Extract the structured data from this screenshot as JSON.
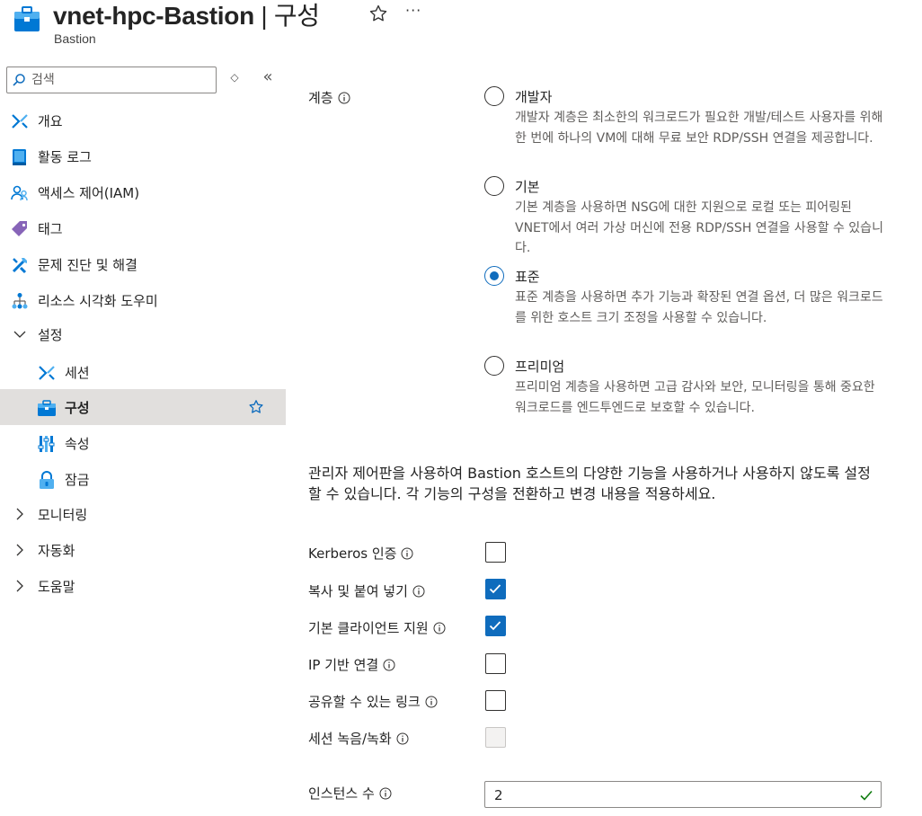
{
  "header": {
    "resource_name": "vnet-hpc-Bastion",
    "separator": " | ",
    "page_name": "구성",
    "subtitle": "Bastion",
    "more_label": "···"
  },
  "sidebar": {
    "search_placeholder": "검색",
    "sort_glyph": "◇",
    "collapse_glyph": "«",
    "items": [
      {
        "label": "개요",
        "icon": "overview-icon"
      },
      {
        "label": "활동 로그",
        "icon": "activity-log-icon"
      },
      {
        "label": "액세스 제어(IAM)",
        "icon": "iam-icon"
      },
      {
        "label": "태그",
        "icon": "tag-icon"
      },
      {
        "label": "문제 진단 및 해결",
        "icon": "diagnose-icon"
      },
      {
        "label": "리소스 시각화 도우미",
        "icon": "resource-visualizer-icon"
      },
      {
        "label": "설정",
        "icon": "chevron-down-icon",
        "expanded": true
      },
      {
        "label": "세션",
        "icon": "session-icon"
      },
      {
        "label": "구성",
        "icon": "configuration-icon",
        "selected": true
      },
      {
        "label": "속성",
        "icon": "properties-icon"
      },
      {
        "label": "잠금",
        "icon": "lock-icon"
      },
      {
        "label": "모니터링",
        "icon": "chevron-right-icon"
      },
      {
        "label": "자동화",
        "icon": "chevron-right-icon"
      },
      {
        "label": "도움말",
        "icon": "chevron-right-icon"
      }
    ]
  },
  "tier": {
    "label": "계층",
    "options": [
      {
        "title": "개발자",
        "description": "개발자 계층은 최소한의 워크로드가 필요한 개발/테스트 사용자를 위해 한 번에 하나의 VM에 대해 무료 보안 RDP/SSH 연결을 제공합니다.",
        "checked": false
      },
      {
        "title": "기본",
        "description": "기본 계층을 사용하면 NSG에 대한 지원으로 로컬 또는 피어링된 VNET에서 여러 가상 머신에 전용 RDP/SSH 연결을 사용할 수 있습니다.",
        "checked": false
      },
      {
        "title": "표준",
        "description": "표준 계층을 사용하면 추가 기능과 확장된 연결 옵션, 더 많은 워크로드를 위한 호스트 크기 조정을 사용할 수 있습니다.",
        "checked": true
      },
      {
        "title": "프리미엄",
        "description": "프리미엄 계층을 사용하면 고급 감사와 보안, 모니터링을 통해 중요한 워크로드를 엔드투엔드로 보호할 수 있습니다.",
        "checked": false
      }
    ]
  },
  "features_intro": "관리자 제어판을 사용하여 Bastion 호스트의 다양한 기능을 사용하거나 사용하지 않도록 설정할 수 있습니다. 각 기능의 구성을 전환하고 변경 내용을 적용하세요.",
  "features": [
    {
      "label": "Kerberos 인증",
      "checked": false,
      "disabled": false
    },
    {
      "label": "복사 및 붙여 넣기",
      "checked": true,
      "disabled": false
    },
    {
      "label": "기본 클라이언트 지원",
      "checked": true,
      "disabled": false
    },
    {
      "label": "IP 기반 연결",
      "checked": false,
      "disabled": false
    },
    {
      "label": "공유할 수 있는 링크",
      "checked": false,
      "disabled": false
    },
    {
      "label": "세션 녹음/녹화",
      "checked": false,
      "disabled": true
    }
  ],
  "instance_count": {
    "label": "인스턴스 수",
    "value": "2"
  },
  "colors": {
    "accent": "#0f6cbd",
    "selected_bg": "#e1dfdd",
    "valid": "#107c10"
  }
}
